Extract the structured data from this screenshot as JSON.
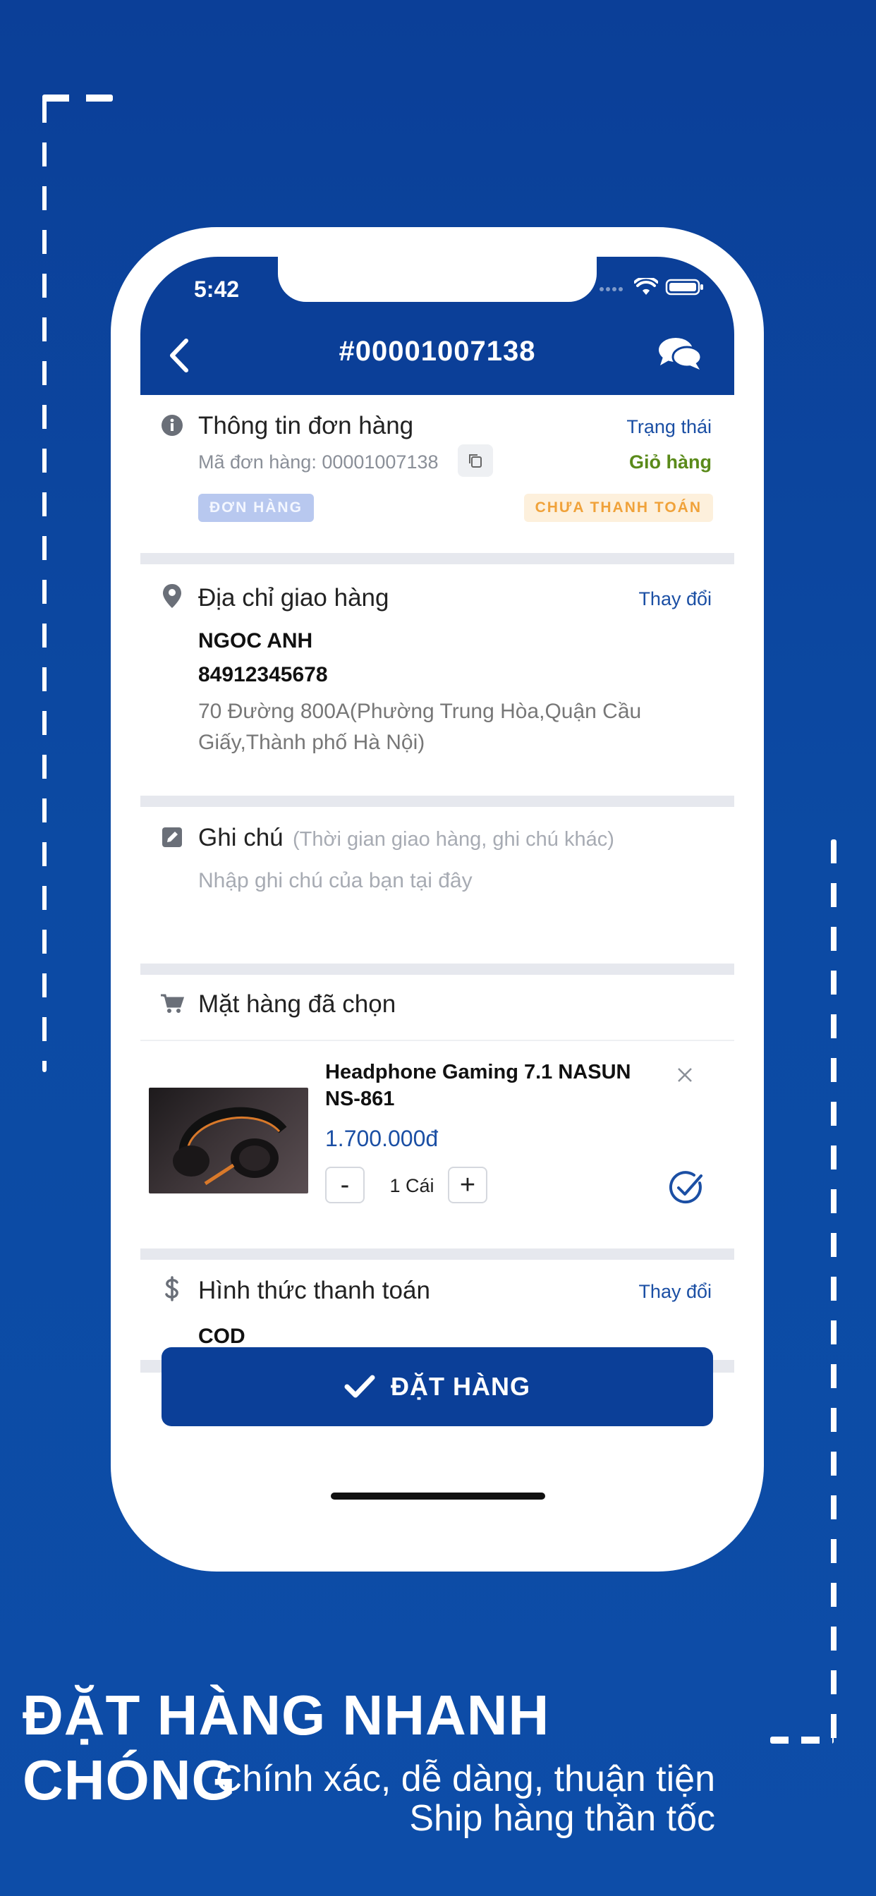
{
  "colors": {
    "primary": "#0b3f98",
    "link": "#1b4fa4",
    "green": "#5a8a1a",
    "badge_blue_bg": "#b8c8ef",
    "badge_orange_bg": "#fdf0dc",
    "badge_orange_text": "#f0a23a"
  },
  "status_bar": {
    "time": "5:42"
  },
  "header": {
    "order_number": "#00001007138"
  },
  "order_info": {
    "title": "Thông tin đơn hàng",
    "status_label": "Trạng thái",
    "order_code": "Mã đơn hàng: 00001007138",
    "status_value": "Giỏ hàng",
    "type_badge": "ĐƠN HÀNG",
    "payment_badge": "CHƯA THANH TOÁN"
  },
  "shipping": {
    "title": "Địa chỉ giao hàng",
    "change_label": "Thay đổi",
    "name": "NGOC ANH",
    "phone": "84912345678",
    "address_line1": "70 Đường 800A(Phường Trung Hòa,Quận Cầu",
    "address_line2": "Giấy,Thành phố Hà Nội)"
  },
  "note": {
    "title": "Ghi chú",
    "hint": "(Thời gian giao hàng, ghi chú khác)",
    "placeholder": "Nhập ghi chú của bạn tại đây"
  },
  "items": {
    "title": "Mặt hàng đã chọn",
    "list": [
      {
        "name_line1": "Headphone Gaming 7.1 NASUN",
        "name_line2": "NS-861",
        "price": "1.700.000đ",
        "minus": "-",
        "quantity": "1 Cái",
        "plus": "+"
      }
    ]
  },
  "payment": {
    "title": "Hình thức thanh toán",
    "change_label": "Thay đổi",
    "method": "COD"
  },
  "order_button": {
    "label": "ĐẶT HÀNG"
  },
  "promo": {
    "headline": "ĐẶT HÀNG NHANH CHÓNG",
    "subline1": "Chính xác, dễ dàng, thuận tiện",
    "subline2": "Ship hàng thần tốc"
  }
}
